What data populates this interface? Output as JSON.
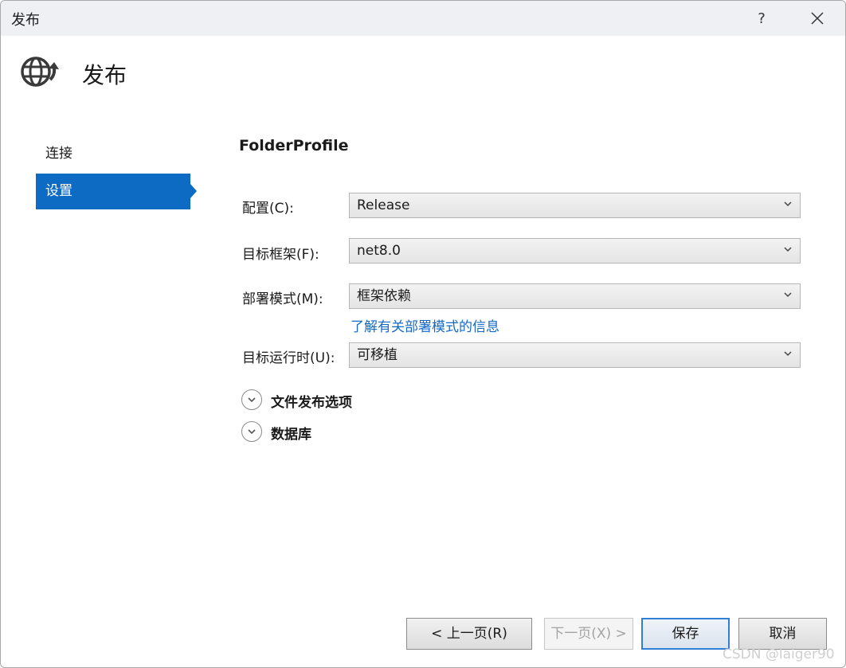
{
  "window": {
    "title": "发布",
    "help_label": "?"
  },
  "header": {
    "title": "发布"
  },
  "nav": {
    "items": [
      {
        "label": "连接",
        "active": false
      },
      {
        "label": "设置",
        "active": true
      }
    ]
  },
  "profile": {
    "name": "FolderProfile"
  },
  "fields": {
    "configuration": {
      "label": "配置(C):",
      "value": "Release"
    },
    "target_framework": {
      "label": "目标框架(F):",
      "value": "net8.0"
    },
    "deployment_mode": {
      "label": "部署模式(M):",
      "value": "框架依赖",
      "help_link": "了解有关部署模式的信息"
    },
    "target_runtime": {
      "label": "目标运行时(U):",
      "value": "可移植"
    }
  },
  "sections": [
    {
      "label": "文件发布选项",
      "expanded": false
    },
    {
      "label": "数据库",
      "expanded": false
    }
  ],
  "buttons": {
    "previous": "< 上一页(R)",
    "next": "下一页(X) >",
    "save": "保存",
    "cancel": "取消"
  },
  "watermark": "CSDN @laiger90",
  "colors": {
    "accent": "#0e6bc4",
    "link": "#1569c7",
    "titlebar": "#eef0f4"
  },
  "icons": [
    "globe-publish-icon",
    "help-icon",
    "close-icon",
    "chevron-down-icon",
    "expand-circle-icon"
  ]
}
